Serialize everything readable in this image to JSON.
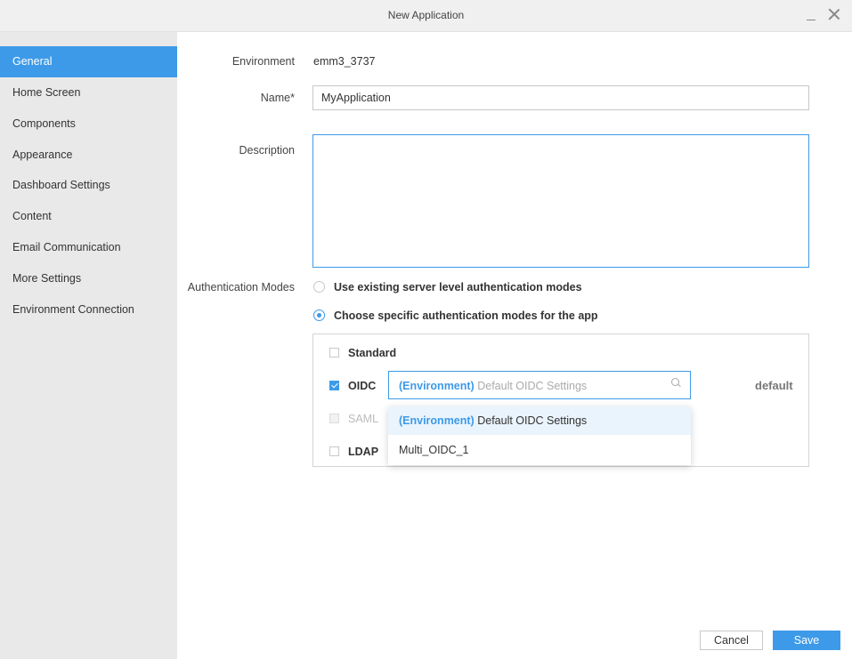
{
  "window": {
    "title": "New Application"
  },
  "sidebar": {
    "items": [
      {
        "label": "General"
      },
      {
        "label": "Home Screen"
      },
      {
        "label": "Components"
      },
      {
        "label": "Appearance"
      },
      {
        "label": "Dashboard Settings"
      },
      {
        "label": "Content"
      },
      {
        "label": "Email Communication"
      },
      {
        "label": "More Settings"
      },
      {
        "label": "Environment Connection"
      }
    ],
    "active_index": 0
  },
  "form": {
    "environment_label": "Environment",
    "environment_value": "emm3_3737",
    "name_label": "Name*",
    "name_value": "MyApplication",
    "description_label": "Description",
    "description_value": "",
    "auth_label": "Authentication Modes",
    "auth_option_existing": "Use existing server level authentication modes",
    "auth_option_specific": "Choose specific authentication modes for the app",
    "auth_selected": "specific"
  },
  "auth_modes": {
    "standard": {
      "label": "Standard",
      "checked": false
    },
    "oidc": {
      "label": "OIDC",
      "checked": true
    },
    "saml": {
      "label": "SAML",
      "checked": false,
      "disabled": true
    },
    "ldap": {
      "label": "LDAP",
      "checked": false
    },
    "oidc_select": {
      "tag": "(Environment)",
      "placeholder": "Default OIDC Settings"
    },
    "default_label": "default",
    "dropdown_options": [
      {
        "tag": "(Environment)",
        "label": "Default OIDC Settings"
      },
      {
        "tag": "",
        "label": "Multi_OIDC_1"
      }
    ]
  },
  "footer": {
    "cancel_label": "Cancel",
    "save_label": "Save"
  },
  "colors": {
    "accent": "#3d9ae8",
    "sidebar_bg": "#e9e9e9",
    "titlebar_bg": "#f0f0f0"
  }
}
